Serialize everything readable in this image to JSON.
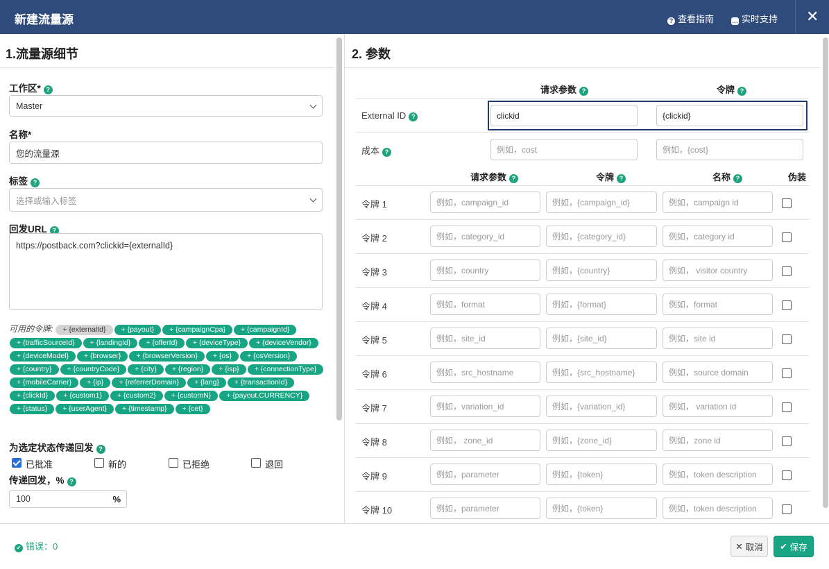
{
  "header": {
    "title": "新建流量源",
    "guide": "查看指南",
    "support": "实时支持",
    "close": "✕"
  },
  "left": {
    "section_title": "1.流量源细节",
    "workspace_label": "工作区*",
    "workspace_value": "Master",
    "name_label": "名称*",
    "name_value": "您的流量源",
    "tags_label": "标签",
    "tags_placeholder": "选择或输入标签",
    "postback_label": "回发URL",
    "postback_value": "https://postback.com?clickid={externalId}",
    "tokens_label": "可用的令牌:",
    "tokens": [
      "+ {externalId}",
      "+ {payout}",
      "+ {campaignCpa}",
      "+ {campaignId}",
      "+ {trafficSourceId}",
      "+ {landingId}",
      "+ {offerId}",
      "+ {deviceType}",
      "+ {deviceVendor}",
      "+ {deviceModel}",
      "+ {browser}",
      "+ {browserVersion}",
      "+ {os}",
      "+ {osVersion}",
      "+ {country}",
      "+ {countryCode}",
      "+ {city}",
      "+ {region}",
      "+ {isp}",
      "+ {connectionType}",
      "+ {mobileCarrier}",
      "+ {ip}",
      "+ {referrerDomain}",
      "+ {lang}",
      "+ {transactionId}",
      "+ {clickId}",
      "+ {custom1}",
      "+ {custom2}",
      "+ {customN}",
      "+ {payout.CURRENCY}",
      "+ {status}",
      "+ {userAgent}",
      "+ {timestamp}",
      "+ {cet}"
    ],
    "status_label": "为选定状态传递回发",
    "statuses": [
      {
        "label": "已批准",
        "checked": true
      },
      {
        "label": "新的",
        "checked": false
      },
      {
        "label": "已拒绝",
        "checked": false
      },
      {
        "label": "退回",
        "checked": false
      }
    ],
    "pass_label": "传递回发，%",
    "pass_value": "100",
    "pass_unit": "%"
  },
  "right": {
    "section_title": "2. 参数",
    "head_param": "请求参数",
    "head_token": "令牌",
    "head_name": "名称",
    "head_disguise": "伪装",
    "external_id": {
      "label": "External ID",
      "param": "clickid",
      "token": "{clickid}"
    },
    "cost": {
      "label": "成本",
      "param_ph": "例如，cost",
      "token_ph": "例如，{cost}"
    },
    "rows": [
      {
        "label": "令牌 1",
        "param_ph": "例如，campaign_id",
        "token_ph": "例如，{campaign_id}",
        "name_ph": "例如，campaign id"
      },
      {
        "label": "令牌 2",
        "param_ph": "例如，category_id",
        "token_ph": "例如，{category_id}",
        "name_ph": "例如，category id"
      },
      {
        "label": "令牌 3",
        "param_ph": "例如，country",
        "token_ph": "例如，{country}",
        "name_ph": "例如， visitor country"
      },
      {
        "label": "令牌 4",
        "param_ph": "例如，format",
        "token_ph": "例如，{format}",
        "name_ph": "例如，format"
      },
      {
        "label": "令牌 5",
        "param_ph": "例如，site_id",
        "token_ph": "例如，{site_id}",
        "name_ph": "例如，site id"
      },
      {
        "label": "令牌 6",
        "param_ph": "例如，src_hostname",
        "token_ph": "例如，{src_hostname}",
        "name_ph": "例如，source domain"
      },
      {
        "label": "令牌 7",
        "param_ph": "例如，variation_id",
        "token_ph": "例如，{variation_id}",
        "name_ph": "例如， variation id"
      },
      {
        "label": "令牌 8",
        "param_ph": "例如， zone_id",
        "token_ph": "例如，{zone_id}",
        "name_ph": "例如，zone id"
      },
      {
        "label": "令牌 9",
        "param_ph": "例如，parameter",
        "token_ph": "例如，{token}",
        "name_ph": "例如，token description"
      },
      {
        "label": "令牌 10",
        "param_ph": "例如，parameter",
        "token_ph": "例如，{token}",
        "name_ph": "例如，token description"
      }
    ]
  },
  "footer": {
    "errors": "错误：0",
    "cancel": "取消",
    "save": "保存"
  },
  "colors": {
    "header": "#2f4b7c",
    "accent": "#17a583",
    "highlight": "#1f3a6e"
  }
}
